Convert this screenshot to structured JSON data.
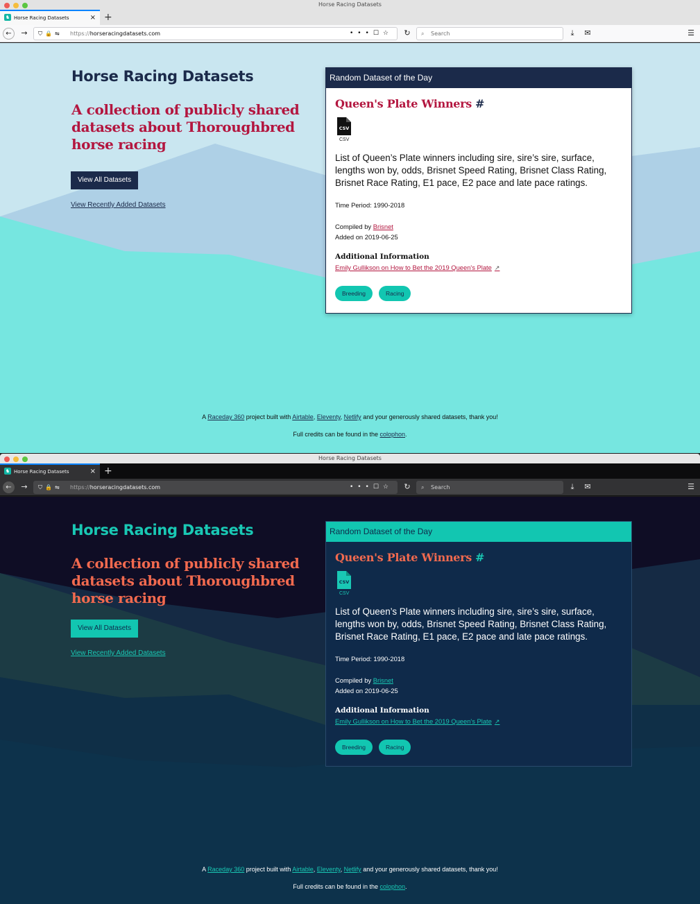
{
  "browser": {
    "window_title": "Horse Racing Datasets",
    "tab_title": "Horse Racing Datasets",
    "tab_close": "×",
    "new_tab": "+",
    "url_scheme": "https://",
    "url_host": "horseracingdatasets.com",
    "search_placeholder": "Search",
    "icons": {
      "back": "back-arrow-icon",
      "forward": "forward-arrow-icon",
      "reload": "reload-icon",
      "download": "download-icon",
      "mail": "mail-icon",
      "menu": "hamburger-menu-icon"
    }
  },
  "site": {
    "title": "Horse Racing Datasets",
    "tagline": "A collection of publicly shared datasets about Thoroughbred horse racing",
    "view_all_label": "View All Datasets",
    "view_recent_label": "View Recently Added Datasets"
  },
  "card": {
    "header": "Random Dataset of the Day",
    "title": "Queen's Plate Winners",
    "hash": "#",
    "file_type": "CSV",
    "description": "List of Queen’s Plate winners including sire, sire’s sire, surface, lengths won by, odds, Brisnet Speed Rating, Brisnet Class Rating, Brisnet Race Rating, E1 pace, E2 pace and late pace ratings.",
    "time_period": "Time Period: 1990-2018",
    "compiled_prefix": "Compiled by ",
    "compiled_by": "Brisnet",
    "added_on": "Added on 2019-06-25",
    "additional_title": "Additional Information",
    "additional_link": "Emily Gullikson on How to Bet the 2019 Queen's Plate",
    "tags": [
      "Breeding",
      "Racing"
    ]
  },
  "footer": {
    "line1_prefix": "A ",
    "link_raceday": "Raceday 360",
    "line1_mid": " project built with ",
    "link_airtable": "Airtable",
    "sep1": ", ",
    "link_eleventy": "Eleventy",
    "sep2": ", ",
    "link_netlify": "Netlify",
    "line1_suffix": " and your generously shared datasets, thank you!",
    "line2_prefix": "Full credits can be found in the ",
    "link_colophon": "colophon",
    "line2_suffix": "."
  },
  "themes": {
    "light": {
      "navy": "#1b2a4a",
      "crimson": "#b3163f",
      "teal": "#12c6b1",
      "sky": "#c9e6f0"
    },
    "dark": {
      "bg": "#0f0d25",
      "card": "#0f2a4a",
      "teal": "#12c6b1",
      "coral": "#f26a4f"
    }
  }
}
